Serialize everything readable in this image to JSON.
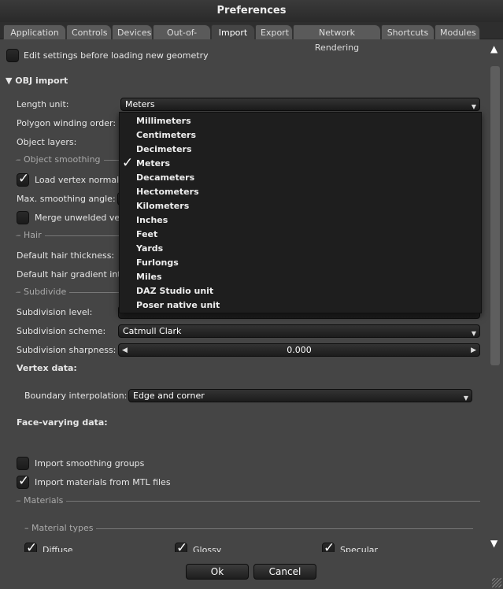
{
  "window": {
    "title": "Preferences"
  },
  "tabs": [
    {
      "label": "Application"
    },
    {
      "label": "Controls"
    },
    {
      "label": "Devices"
    },
    {
      "label": "Out-of-core"
    },
    {
      "label": "Import",
      "active": true
    },
    {
      "label": "Export"
    },
    {
      "label": "Network Rendering"
    },
    {
      "label": "Shortcuts"
    },
    {
      "label": "Modules"
    }
  ],
  "import": {
    "edit_settings": {
      "label": "Edit settings before loading new geometry",
      "checked": false
    },
    "obj_section": "▼ OBJ import",
    "length_unit": {
      "label": "Length unit:",
      "value": "Meters"
    },
    "polygon_winding": {
      "label": "Polygon winding order:"
    },
    "object_layers": {
      "label": "Object layers:"
    },
    "object_smoothing": "– Object smoothing",
    "load_vertex_normals": {
      "label": "Load vertex normals",
      "checked": true
    },
    "max_smoothing": {
      "label": "Max. smoothing angle:"
    },
    "merge_unwelded": {
      "label": "Merge unwelded ver",
      "checked": false
    },
    "hair": "– Hair",
    "hair_thickness": {
      "label": "Default hair thickness:"
    },
    "hair_gradient": {
      "label": "Default hair gradient inte"
    },
    "subdivide": "– Subdivide",
    "subdivision_level": {
      "label": "Subdivision level:"
    },
    "subdivision_scheme": {
      "label": "Subdivision scheme:",
      "value": "Catmull Clark"
    },
    "subdivision_sharpness": {
      "label": "Subdivision sharpness:",
      "value": "0.000"
    },
    "vertex_data": "Vertex data:",
    "boundary_interpolation": {
      "label": "Boundary interpolation:",
      "value": "Edge and corner"
    },
    "face_varying": "Face-varying data:",
    "import_smoothing_groups": {
      "label": "Import smoothing groups",
      "checked": false
    },
    "import_materials": {
      "label": "Import materials from MTL files",
      "checked": true
    },
    "materials": "– Materials",
    "material_types": "– Material types",
    "types": [
      {
        "label": "Diffuse",
        "checked": true
      },
      {
        "label": "Glossy",
        "checked": true
      },
      {
        "label": "Specular",
        "checked": true
      }
    ]
  },
  "length_unit_options": [
    "Millimeters",
    "Centimeters",
    "Decimeters",
    "Meters",
    "Decameters",
    "Hectometers",
    "Kilometers",
    "Inches",
    "Feet",
    "Yards",
    "Furlongs",
    "Miles",
    "DAZ Studio unit",
    "Poser native unit"
  ],
  "selected_option": "Meters",
  "buttons": {
    "ok": "Ok",
    "cancel": "Cancel"
  }
}
